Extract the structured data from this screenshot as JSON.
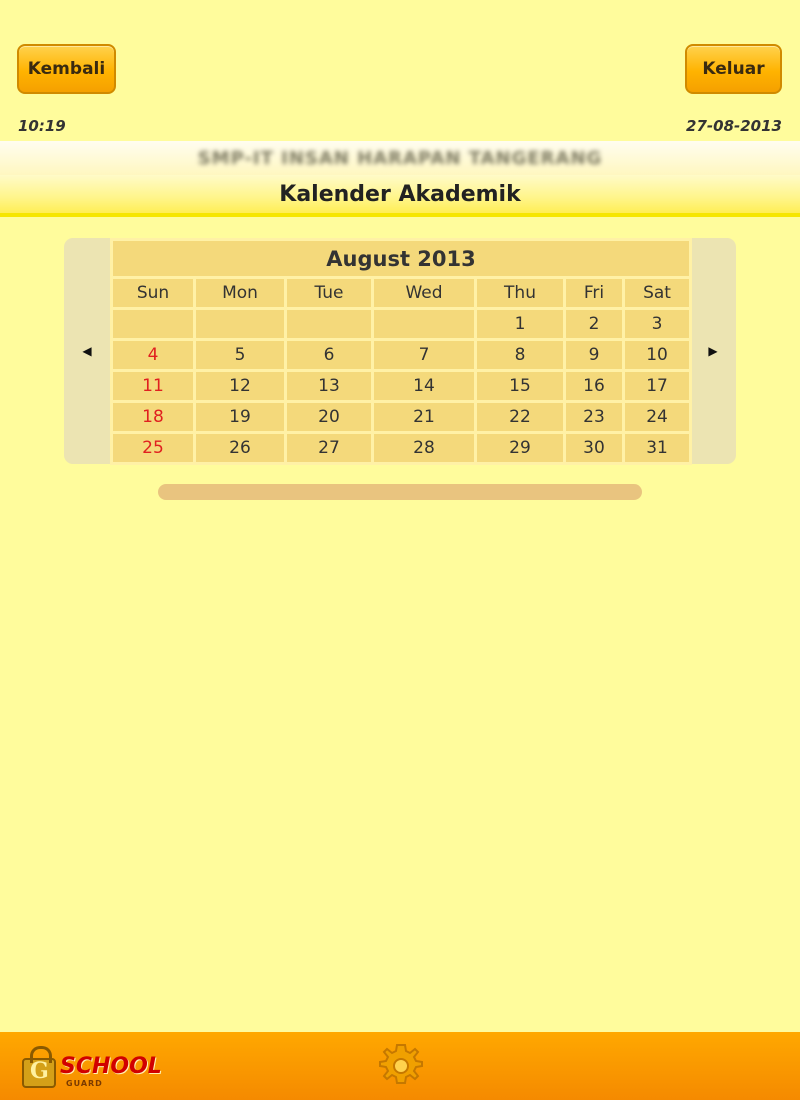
{
  "header": {
    "back_label": "Kembali",
    "exit_label": "Keluar",
    "time": "10:19",
    "date": "27-08-2013",
    "school_name": "SMP-IT INSAN HARAPAN TANGERANG",
    "page_title": "Kalender Akademik"
  },
  "calendar": {
    "month_label": "August 2013",
    "prev_icon": "triangle-left",
    "next_icon": "triangle-right",
    "weekdays": [
      "Sun",
      "Mon",
      "Tue",
      "Wed",
      "Thu",
      "Fri",
      "Sat"
    ],
    "weeks": [
      [
        "",
        "",
        "",
        "",
        "1",
        "2",
        "3"
      ],
      [
        "4",
        "5",
        "6",
        "7",
        "8",
        "9",
        "10"
      ],
      [
        "11",
        "12",
        "13",
        "14",
        "15",
        "16",
        "17"
      ],
      [
        "18",
        "19",
        "20",
        "21",
        "22",
        "23",
        "24"
      ],
      [
        "25",
        "26",
        "27",
        "28",
        "29",
        "30",
        "31"
      ]
    ],
    "sunday_color": "#e02020"
  },
  "footer": {
    "logo_text": "SCHOOL",
    "logo_letter": "G",
    "logo_sub": "GUARD",
    "settings_icon": "gear-icon"
  }
}
